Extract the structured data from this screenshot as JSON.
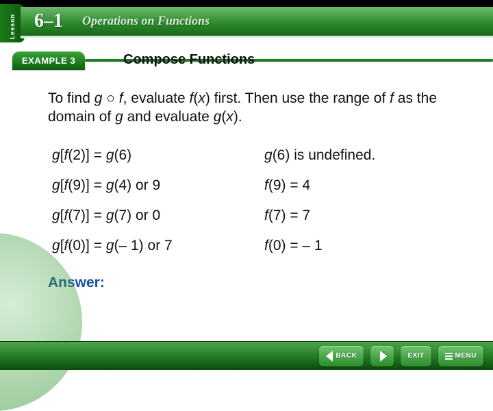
{
  "lesson_tab": "Lesson",
  "chapter": {
    "number": "6–1",
    "title": "Operations on Functions"
  },
  "example": {
    "label": "EXAMPLE 3",
    "subhead": "Compose Functions"
  },
  "body": {
    "intro_1": "To find ",
    "intro_comp": "g ○ f",
    "intro_2": ", evaluate ",
    "intro_fx_f": "f",
    "intro_fx_paren": "(",
    "intro_fx_x": "x",
    "intro_fx_close": ")",
    "intro_3": " first. Then use the range of ",
    "intro_f2": "f",
    "intro_4": " as the domain of ",
    "intro_g": "g",
    "intro_5": " and evaluate ",
    "intro_gx_g": "g",
    "intro_gx_paren": "(",
    "intro_gx_x": "x",
    "intro_gx_close": ").",
    "rows": [
      {
        "l_prefix": "g",
        "l_br_open": "[",
        "l_f": "f",
        "l_arg": "(2)] = ",
        "l_res_g": "g",
        "l_res": "(6)",
        "r_g": "g",
        "r_txt": "(6) is undefined."
      },
      {
        "l_prefix": "g",
        "l_br_open": "[",
        "l_f": "f",
        "l_arg": "(9)] = ",
        "l_res_g": "g",
        "l_res": "(4) or 9",
        "r_g": "f",
        "r_txt": "(9) = 4"
      },
      {
        "l_prefix": "g",
        "l_br_open": "[",
        "l_f": "f",
        "l_arg": "(7)] = ",
        "l_res_g": "g",
        "l_res": "(7) or 0",
        "r_g": "f",
        "r_txt": "(7) = 7"
      },
      {
        "l_prefix": "g",
        "l_br_open": "[",
        "l_f": "f",
        "l_arg": "(0)] = ",
        "l_res_g": "g",
        "l_res": "(– 1) or 7",
        "r_g": "f",
        "r_txt": "(0) = – 1"
      }
    ],
    "answer_label": "Answer:"
  },
  "nav": {
    "back": "BACK",
    "exit": "EXIT",
    "menu": "MENU"
  }
}
